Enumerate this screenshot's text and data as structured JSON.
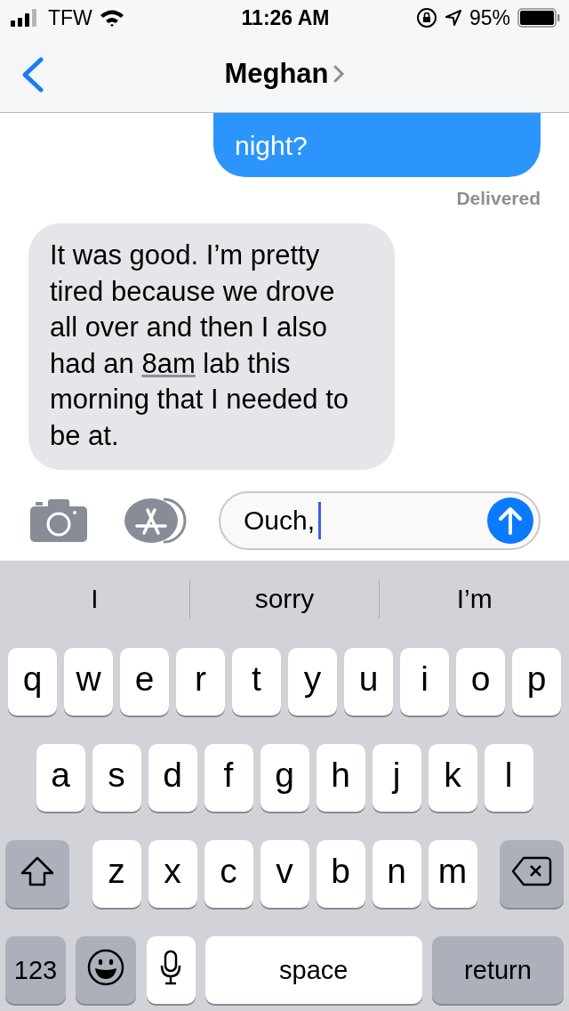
{
  "status_bar": {
    "carrier": "TFW",
    "time": "11:26 AM",
    "battery": "95%"
  },
  "nav": {
    "title": "Meghan"
  },
  "messages": [
    {
      "kind": "sent",
      "segments": [
        {
          "text": "night?"
        }
      ]
    },
    {
      "kind": "receipt",
      "segments": [
        {
          "text": "Delivered"
        }
      ]
    },
    {
      "kind": "received",
      "segments": [
        {
          "text": "It was good. I’m pretty tired because we drove all over and then I also had an "
        },
        {
          "text": "8am",
          "kind": "link"
        },
        {
          "text": " lab this morning that I needed to be at."
        }
      ]
    }
  ],
  "compose": {
    "value": "Ouch,"
  },
  "suggestions": [
    "I",
    "sorry",
    "I’m"
  ],
  "keyboard": [
    [
      {
        "kind": "letter",
        "label": "q"
      },
      {
        "kind": "letter",
        "label": "w"
      },
      {
        "kind": "letter",
        "label": "e"
      },
      {
        "kind": "letter",
        "label": "r"
      },
      {
        "kind": "letter",
        "label": "t"
      },
      {
        "kind": "letter",
        "label": "y"
      },
      {
        "kind": "letter",
        "label": "u"
      },
      {
        "kind": "letter",
        "label": "i"
      },
      {
        "kind": "letter",
        "label": "o"
      },
      {
        "kind": "letter",
        "label": "p"
      }
    ],
    [
      {
        "kind": "letter",
        "label": "a"
      },
      {
        "kind": "letter",
        "label": "s"
      },
      {
        "kind": "letter",
        "label": "d"
      },
      {
        "kind": "letter",
        "label": "f"
      },
      {
        "kind": "letter",
        "label": "g"
      },
      {
        "kind": "letter",
        "label": "h"
      },
      {
        "kind": "letter",
        "label": "j"
      },
      {
        "kind": "letter",
        "label": "k"
      },
      {
        "kind": "letter",
        "label": "l"
      }
    ],
    [
      {
        "kind": "shift"
      },
      {
        "kind": "letter",
        "label": "z"
      },
      {
        "kind": "letter",
        "label": "x"
      },
      {
        "kind": "letter",
        "label": "c"
      },
      {
        "kind": "letter",
        "label": "v"
      },
      {
        "kind": "letter",
        "label": "b"
      },
      {
        "kind": "letter",
        "label": "n"
      },
      {
        "kind": "letter",
        "label": "m"
      },
      {
        "kind": "delete"
      }
    ],
    [
      {
        "kind": "numbers",
        "label": "123"
      },
      {
        "kind": "emoji"
      },
      {
        "kind": "mic"
      },
      {
        "kind": "space",
        "label": "space"
      },
      {
        "kind": "return",
        "label": "return"
      }
    ]
  ]
}
